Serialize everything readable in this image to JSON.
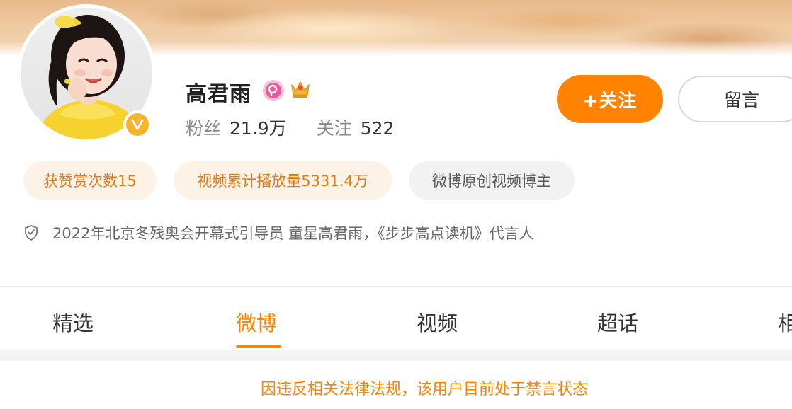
{
  "profile": {
    "name": "高君雨",
    "stats": [
      {
        "label": "粉丝",
        "value": "21.9万"
      },
      {
        "label": "关注",
        "value": "522"
      }
    ],
    "verified": true
  },
  "actions": {
    "follow_label": "+关注",
    "message_label": "留言"
  },
  "tags": [
    "获赞赏次数15",
    "视频累计播放量5331.4万",
    "微博原创视频博主"
  ],
  "bio": "2022年北京冬残奥会开幕式引导员 童星高君雨，《步步高点读机》代言人",
  "tabs": [
    {
      "label": "精选",
      "active": false
    },
    {
      "label": "微博",
      "active": true
    },
    {
      "label": "视频",
      "active": false
    },
    {
      "label": "超话",
      "active": false
    },
    {
      "label": "相",
      "active": false
    }
  ],
  "notice": "因违反相关法律法规，该用户目前处于禁言状态",
  "colors": {
    "accent": "#ff8200",
    "tag_text": "#e07a1a",
    "tag_bg": "#fdf2e6",
    "verified_badge": "#f7b52c",
    "vip_badge": "#e85a9b"
  },
  "icons": [
    "verified-v-icon",
    "vip-level-icon",
    "crown-icon",
    "shield-icon"
  ]
}
